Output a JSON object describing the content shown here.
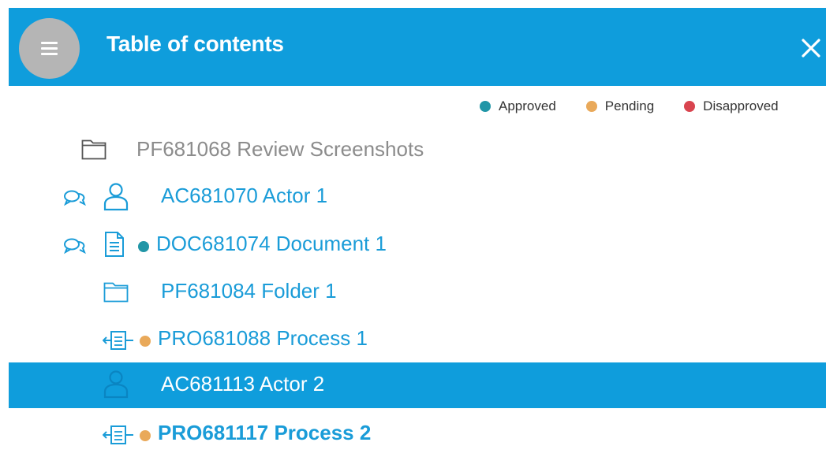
{
  "header": {
    "title": "Table of contents"
  },
  "legend": [
    {
      "label": "Approved",
      "color": "#2196a7"
    },
    {
      "label": "Pending",
      "color": "#e9a95a"
    },
    {
      "label": "Disapproved",
      "color": "#d9444f"
    }
  ],
  "tree": [
    {
      "label": "PF681068 Review Screenshots",
      "type": "folder-icon"
    },
    {
      "label": "AC681070 Actor 1",
      "type": "actor-icon"
    },
    {
      "label": "DOC681074 Document 1",
      "type": "document-icon",
      "status": "Approved"
    },
    {
      "label": "PF681084 Folder 1",
      "type": "folder-icon"
    },
    {
      "label": "PRO681088 Process 1",
      "type": "process-icon",
      "status": "Pending"
    },
    {
      "label": "AC681113 Actor 2",
      "type": "actor-icon",
      "selected": true
    },
    {
      "label": "PRO681117 Process 2",
      "type": "process-icon",
      "status": "Pending"
    }
  ]
}
